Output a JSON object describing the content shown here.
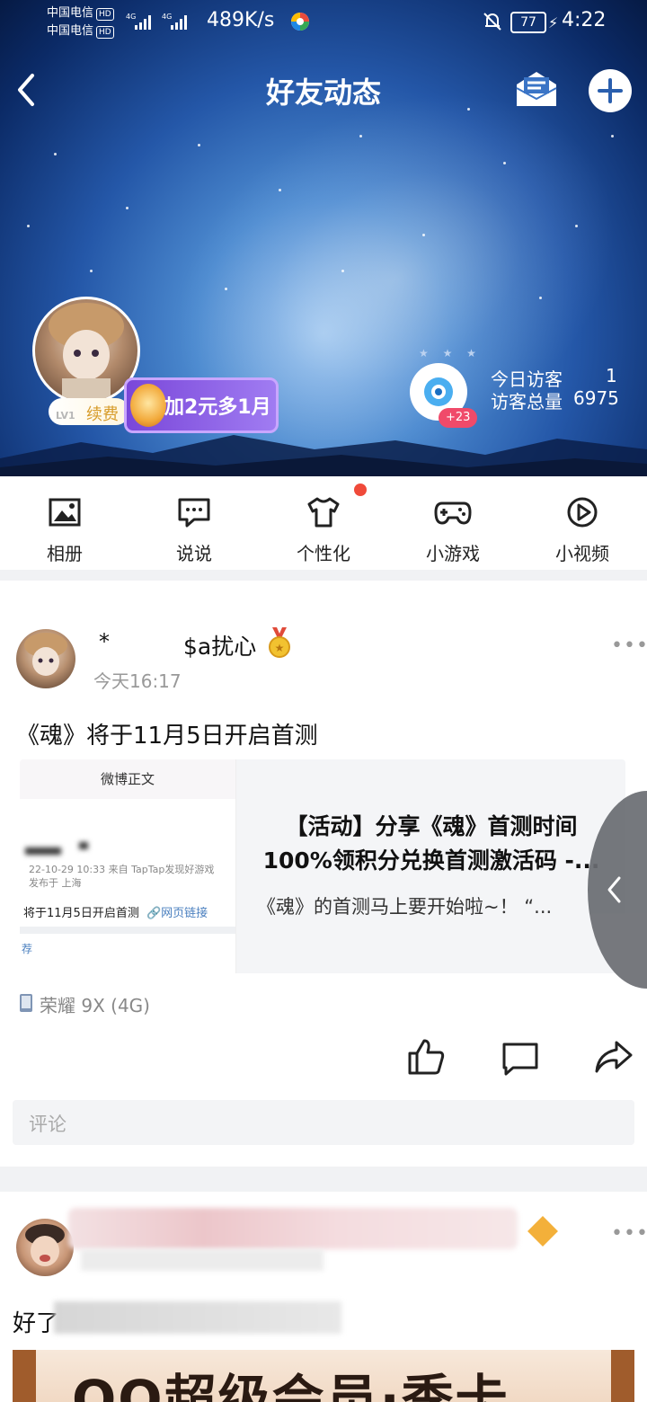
{
  "status_bar": {
    "carrier1": "中国电信",
    "carrier2": "中国电信",
    "hd": "HD",
    "net": "4G",
    "speed": "489K/s",
    "battery": "77",
    "time": "4:22"
  },
  "header": {
    "title": "好友动态",
    "renew_label": "续费",
    "level_label": "LV1",
    "promo_label": "加2元多1月",
    "visitor_badge": "+23",
    "today_visitors_label": "今日访客",
    "today_visitors_value": "1",
    "total_visitors_label": "访客总量",
    "total_visitors_value": "6975"
  },
  "tabs": [
    {
      "label": "相册",
      "icon": "photo-album-icon"
    },
    {
      "label": "说说",
      "icon": "chat-bubble-icon"
    },
    {
      "label": "个性化",
      "icon": "tshirt-icon",
      "has_dot": true
    },
    {
      "label": "小游戏",
      "icon": "gamepad-icon"
    },
    {
      "label": "小视频",
      "icon": "play-circle-icon"
    }
  ],
  "post": {
    "author_prefix": "*",
    "author_name": "$a扰心",
    "time": "今天16:17",
    "text": "《魂》将于11月5日开启首测",
    "link_card": {
      "thumb_header": "微博正文",
      "thumb_meta1": "22-10-29 10:33  来自 TapTap发现好游戏",
      "thumb_meta2": "发布于 上海",
      "thumb_body": "将于11月5日开启首测",
      "thumb_link": "网页链接",
      "thumb_footer": "荐",
      "title": "【活动】分享《魂》首测时间100%领积分兑换首测激活码 -...",
      "desc": "《魂》的首测马上要开始啦~！ “..."
    },
    "device": "荣耀 9X (4G)",
    "comment_placeholder": "评论"
  },
  "post2": {
    "text_visible": "好了",
    "banner_text": "QQ超级会员·季卡"
  },
  "colors": {
    "accent_blue": "#2d7ee8",
    "red_dot": "#f04a3a",
    "promo_purple": "#8d5be8",
    "renew_gold": "#d79c2a"
  }
}
